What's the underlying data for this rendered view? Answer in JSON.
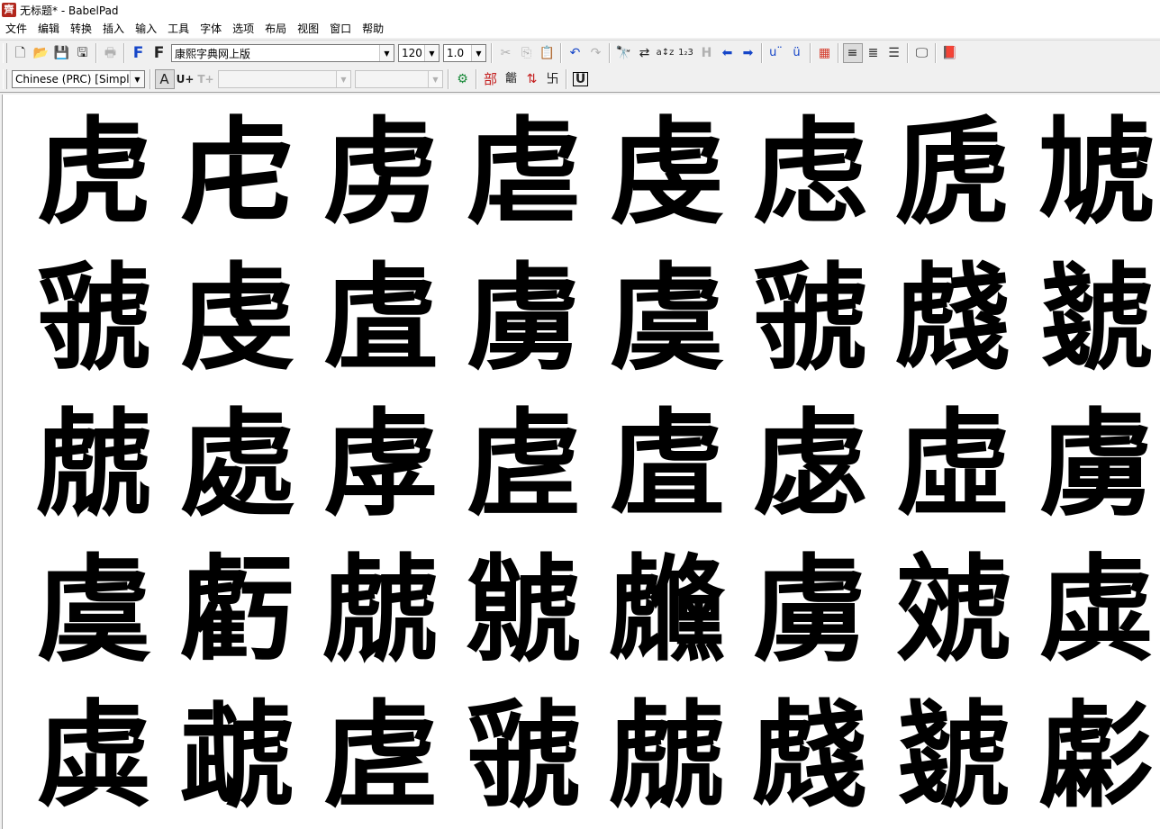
{
  "window": {
    "title": "无标题* - BabelPad",
    "app_icon": "齊"
  },
  "menu": [
    "文件",
    "编辑",
    "转换",
    "插入",
    "输入",
    "工具",
    "字体",
    "选项",
    "布局",
    "视图",
    "窗口",
    "帮助"
  ],
  "toolbar1": {
    "font_name": "康熙字典网上版",
    "font_size": "120",
    "line_spacing": "1.0",
    "bold_f": "F",
    "plain_f": "F",
    "icons": {
      "new": "🗋",
      "open": "📂",
      "save": "💾",
      "save_all": "🖫",
      "print": "🖶",
      "cut": "✂",
      "copy": "⎘",
      "paste": "📋",
      "undo": "↶",
      "redo": "↷",
      "find": "🔭",
      "replace": "⇄",
      "sort": "a↕z",
      "number": "1₂3",
      "h": "H",
      "left": "⬅",
      "right": "➡",
      "u_dd": "u¨",
      "u_uml": "ü",
      "color": "▦",
      "align_left": "≡",
      "align_right": "≣",
      "justify": "☰",
      "monitor": "🖵",
      "book": "📕"
    }
  },
  "toolbar2": {
    "language": "Chinese (PRC) [Simplif",
    "a_label": "A",
    "uplus": "U+",
    "tplus": "T+",
    "radical": "部",
    "radical2": "龤",
    "arrows": "⇅",
    "rl": "卐",
    "u_box": "U",
    "gear": "⚙"
  },
  "glyph_rows": [
    [
      "虎",
      "虍",
      "虏",
      "虐",
      "虔",
      "虑",
      "虒",
      "虓"
    ],
    [
      "虢",
      "虔",
      "虘",
      "虜",
      "虞",
      "虢",
      "虥",
      "虦"
    ],
    [
      "虤",
      "處",
      "虖",
      "虗",
      "虘",
      "虙",
      "虛",
      "虜"
    ],
    [
      "虞",
      "虧",
      "虤",
      "虩",
      "虪",
      "虜",
      "虠",
      "虡"
    ],
    [
      "虡",
      "虣",
      "虗",
      "虢",
      "虤",
      "虥",
      "虦",
      "虨"
    ]
  ]
}
